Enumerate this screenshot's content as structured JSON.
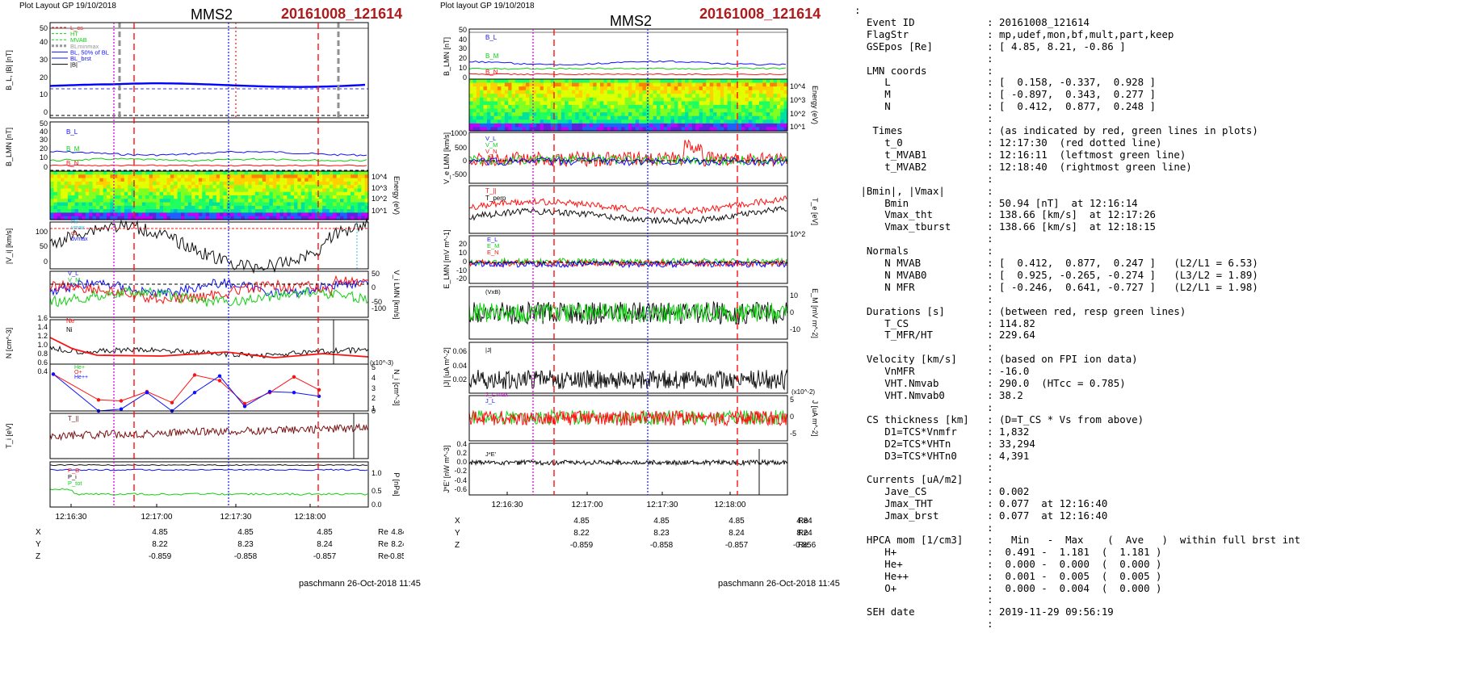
{
  "left_plot": {
    "header": "Plot Layout GP 19/10/2018",
    "spacecraft": "MMS2",
    "event": "20161008_121614",
    "footer": "paschmann 26-Oct-2018 11:45"
  },
  "middle_plot": {
    "header": "Plot layout GP 19/10/2018",
    "spacecraft": "MMS2",
    "event": "20161008_121614",
    "footer": "paschmann 26-Oct-2018 11:45"
  },
  "chart_data": [
    {
      "type": "line",
      "title": "MMS2 20161008_121614 (left column)",
      "x_time_ticks": [
        "12:16:30",
        "12:17:00",
        "12:17:30",
        "12:18:00"
      ],
      "panels": [
        {
          "ylabel": "B_L, |B| [nT]",
          "ylim": [
            0,
            55
          ],
          "ticks": [
            "50",
            "40",
            "30",
            "20",
            "10",
            "0"
          ],
          "legend": [
            "L_cs",
            "HT",
            "MVAB",
            "BLminmax",
            "BL, 50% of BL",
            "BL_brst",
            "|B|"
          ],
          "series": [
            {
              "name": "|B|",
              "values": [
                50.9,
                51,
                51.2,
                51,
                50.8,
                50.9,
                51.1,
                51
              ]
            },
            {
              "name": "BL_brst",
              "values": [
                15,
                16.3,
                17.5,
                16.8,
                16,
                15,
                14,
                13
              ]
            }
          ]
        },
        {
          "ylabel": "B_LMN [nT]",
          "ylim": [
            -5,
            55
          ],
          "ticks": [
            "50",
            "40",
            "30",
            "20",
            "10",
            "0"
          ],
          "legend": [
            "B_L",
            "B_M",
            "B_N"
          ]
        },
        {
          "ylabel": "Energy (eV)",
          "ticks_right": [
            "10^4",
            "10^3",
            "10^2",
            "10^1"
          ]
        },
        {
          "ylabel": "|V_i| [km/s]",
          "ylim": [
            0,
            140
          ],
          "ticks": [
            "100",
            "50",
            "0"
          ],
          "legend": [
            "HT",
            "vmax",
            "cs",
            "dvmax"
          ]
        },
        {
          "ylabel": "V_i LMN [km/s]",
          "ylim": [
            -110,
            60
          ],
          "ticks_right": [
            "50",
            "0",
            "-50",
            "-100"
          ],
          "legend": [
            "V_L",
            "V_M",
            "V_N"
          ]
        },
        {
          "ylabel": "N [cm^-3]",
          "ylim": [
            0.3,
            1.6
          ],
          "ticks": [
            "1.6",
            "1.4",
            "1.2",
            "1.0",
            "0.8",
            "0.6",
            "0.4"
          ],
          "legend": [
            "Ne",
            "Ni"
          ]
        },
        {
          "ylabel": "N_i [cm^-3]",
          "ylim": [
            0,
            5
          ],
          "ticks_right": [
            "5",
            "4",
            "3",
            "2",
            "1",
            "0"
          ],
          "multiplier": "(x10^-3)",
          "legend": [
            "He+",
            "O+",
            "He++"
          ],
          "series": [
            {
              "name": "He+",
              "values": [
                4,
                1.2,
                1.1,
                2.1,
                0.9,
                3.9,
                3.3,
                0.8,
                2.0,
                3.7,
                2.3
              ]
            },
            {
              "name": "He++",
              "values": [
                4,
                0,
                0.2,
                2.0,
                0,
                2.0,
                3.8,
                0.5,
                2.1,
                2.0,
                1.6
              ]
            }
          ]
        },
        {
          "ylabel": "T_i [eV]",
          "legend": [
            "T_||"
          ]
        },
        {
          "ylabel": "P [nPa]",
          "ylim": [
            0,
            1.3
          ],
          "ticks_right": [
            "1.0",
            "0.5",
            "0.0"
          ],
          "legend": [
            "P_B",
            "P_i",
            "P_tot"
          ]
        }
      ],
      "position_table": {
        "rows": [
          {
            "label": "X",
            "values": [
              "4.85",
              "4.85",
              "4.85",
              "4.84"
            ],
            "unit": "Re"
          },
          {
            "label": "Y",
            "values": [
              "8.22",
              "8.23",
              "8.24",
              "8.24"
            ],
            "unit": "Re"
          },
          {
            "label": "Z",
            "values": [
              "-0.859",
              "-0.858",
              "-0.857",
              "-0.856"
            ],
            "unit": "Re"
          }
        ]
      }
    },
    {
      "type": "line",
      "title": "MMS2 20161008_121614 (middle column)",
      "x_time_ticks": [
        "12:16:30",
        "12:17:00",
        "12:17:30",
        "12:18:00"
      ],
      "panels": [
        {
          "ylabel": "B_LMN [nT]",
          "ylim": [
            -2,
            52
          ],
          "ticks": [
            "50",
            "40",
            "30",
            "20",
            "10",
            "0"
          ],
          "legend": [
            "B_L",
            "B_M",
            "B_N"
          ]
        },
        {
          "ylabel": "Energy (eV)",
          "ticks_right": [
            "10^4",
            "10^3",
            "10^2",
            "10^1"
          ]
        },
        {
          "ylabel": "V_e LMN [km/s]",
          "ylim": [
            -750,
            1000
          ],
          "ticks": [
            "1000",
            "500",
            "0",
            "-500"
          ],
          "legend": [
            "V_L",
            "V_M",
            "V_N"
          ]
        },
        {
          "ylabel": "T_e [eV]",
          "ticks_right": [
            "10^2"
          ],
          "legend": [
            "T_||",
            "T_perp"
          ]
        },
        {
          "ylabel": "E_LMN [mV m^-1]",
          "ylim": [
            -25,
            30
          ],
          "ticks": [
            "20",
            "10",
            "0",
            "-10",
            "-20"
          ],
          "legend": [
            "E_L",
            "E_M",
            "E_N"
          ]
        },
        {
          "ylabel": "E_M [mV m^-2]",
          "ticks_right": [
            "10",
            "0",
            "-10"
          ],
          "legend": [
            "(VxB)"
          ]
        },
        {
          "ylabel": "|J| [uA m^-2]",
          "ylim": [
            0,
            0.07
          ],
          "ticks": [
            "0.06",
            "0.04",
            "0.02"
          ],
          "legend": [
            "|J|"
          ]
        },
        {
          "ylabel": "J [uA m^-2]",
          "ylim": [
            -7,
            7
          ],
          "ticks_right": [
            "5",
            "0",
            "-5"
          ],
          "multiplier": "(x10^-2)",
          "legend": [
            "J_L max",
            "J_L"
          ]
        },
        {
          "ylabel": "J*E' [nW m^-3]",
          "ylim": [
            -0.65,
            0.45
          ],
          "ticks": [
            "0.4",
            "0.2",
            "0.0",
            "-0.2",
            "-0.4",
            "-0.6"
          ],
          "legend": [
            "J*E'"
          ]
        }
      ],
      "position_table": {
        "rows": [
          {
            "label": "X",
            "values": [
              "4.85",
              "4.85",
              "4.85",
              "4.84"
            ],
            "unit": "Re"
          },
          {
            "label": "Y",
            "values": [
              "8.22",
              "8.23",
              "8.24",
              "8.24"
            ],
            "unit": "Re"
          },
          {
            "label": "Z",
            "values": [
              "-0.859",
              "-0.858",
              "-0.857",
              "-0.856"
            ],
            "unit": "Re"
          }
        ]
      }
    }
  ],
  "summary": {
    "lines": [
      ":",
      "  Event ID            : 20161008_121614",
      "  FlagStr             : mp,udef,mon,bf,mult,part,keep",
      "  GSEpos [Re]         : [ 4.85, 8.21, -0.86 ]",
      "                      :",
      "  LMN coords          :",
      "     L                : [  0.158, -0.337,  0.928 ]",
      "     M                : [ -0.897,  0.343,  0.277 ]",
      "     N                : [  0.412,  0.877,  0.248 ]",
      "                      :",
      "   Times              : (as indicated by red, green lines in plots)",
      "     t_0              : 12:17:30  (red dotted line)",
      "     t_MVAB1          : 12:16:11  (leftmost green line)",
      "     t_MVAB2          : 12:18:40  (rightmost green line)",
      "                      :",
      " |Bmin|, |Vmax|       :",
      "     Bmin             : 50.94 [nT]  at 12:16:14",
      "     Vmax_tht         : 138.66 [km/s]  at 12:17:26",
      "     Vmax_tburst      : 138.66 [km/s]  at 12:18:15",
      "                      :",
      "  Normals             :",
      "     N MVAB           : [  0.412,  0.877,  0.247 ]   (L2/L1 = 6.53)",
      "     N MVAB0          : [  0.925, -0.265, -0.274 ]   (L3/L2 = 1.89)",
      "     N MFR            : [ -0.246,  0.641, -0.727 ]   (L2/L1 = 1.98)",
      "                      :",
      "  Durations [s]       : (between red, resp green lines)",
      "     T_CS             : 114.82",
      "     T_MFR/HT         : 229.64",
      "                      :",
      "  Velocity [km/s]     : (based on FPI ion data)",
      "     VnMFR            : -16.0",
      "     VHT.Nmvab        : 290.0  (HTcc = 0.785)",
      "     VHT.Nmvab0       : 38.2",
      "                      :",
      "  CS thickness [km]   : (D=T_CS * Vs from above)",
      "     D1=TCS*Vnmfr     : 1,832",
      "     D2=TCS*VHTn      : 33,294",
      "     D3=TCS*VHTn0     : 4,391",
      "                      :",
      "  Currents [uA/m2]    :",
      "     Jave_CS          : 0.002",
      "     Jmax_THT         : 0.077  at 12:16:40",
      "     Jmax_brst        : 0.077  at 12:16:40",
      "                      :",
      "  HPCA mom [1/cm3]    :   Min   -  Max    (  Ave   )  within full brst int",
      "     H+               :  0.491 -  1.181  (  1.181 )",
      "     He+              :  0.000 -  0.000  (  0.000 )",
      "     He++             :  0.001 -  0.005  (  0.005 )",
      "     O+               :  0.000 -  0.004  (  0.000 )",
      "                      :",
      "  SEH date            : 2019-11-29 09:56:19",
      "                      :"
    ]
  },
  "colors": {
    "event": "#b01a1a",
    "red": "#ff1010",
    "green": "#10d010",
    "blue": "#1010ff",
    "magenta": "#e000e0"
  }
}
